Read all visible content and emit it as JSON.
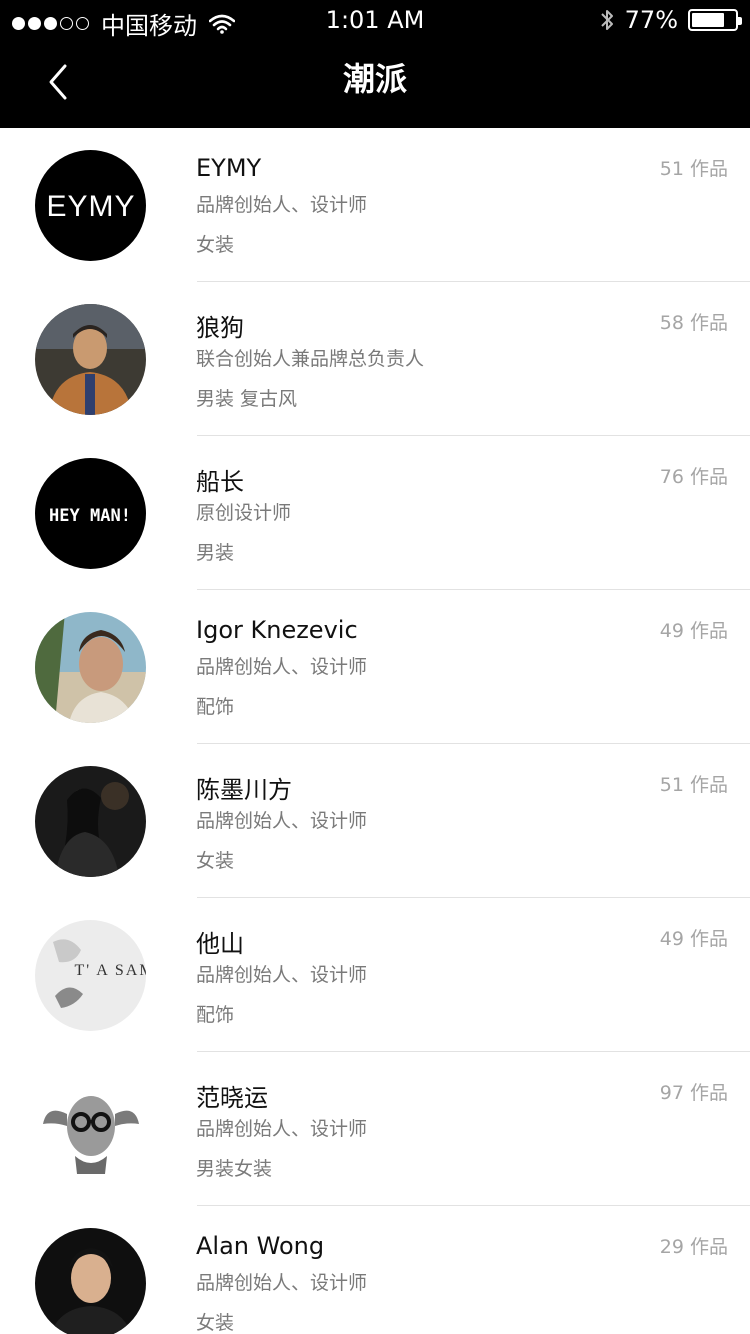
{
  "status_bar": {
    "signal_dots_filled": 3,
    "signal_dots_total": 5,
    "carrier": "中国移动",
    "time": "1:01 AM",
    "battery_percent": "77%",
    "battery_level": 0.77
  },
  "nav": {
    "back_icon": "chevron-left-icon",
    "title": "潮派"
  },
  "designers": [
    {
      "name": "EYMY",
      "role": "品牌创始人、设计师",
      "tags": "女装",
      "works": "51 作品",
      "avatar_text": "EYMY"
    },
    {
      "name": "狼狗",
      "role": "联合创始人兼品牌总负责人",
      "tags": "男装 复古风",
      "works": "58 作品"
    },
    {
      "name": "船长",
      "role": "原创设计师",
      "tags": "男装",
      "works": "76 作品",
      "avatar_text": "HEY MAN!"
    },
    {
      "name": "Igor Knezevic",
      "role": "品牌创始人、设计师",
      "tags": "配饰",
      "works": "49 作品"
    },
    {
      "name": "陈墨川方",
      "role": "品牌创始人、设计师",
      "tags": "女装",
      "works": "51 作品"
    },
    {
      "name": "他山",
      "role": "品牌创始人、设计师",
      "tags": "配饰",
      "works": "49 作品",
      "avatar_text": "T' A SAM"
    },
    {
      "name": "范晓运",
      "role": "品牌创始人、设计师",
      "tags": "男装女装",
      "works": "97 作品"
    },
    {
      "name": "Alan Wong",
      "role": "品牌创始人、设计师",
      "tags": "女装",
      "works": "29 作品"
    }
  ]
}
